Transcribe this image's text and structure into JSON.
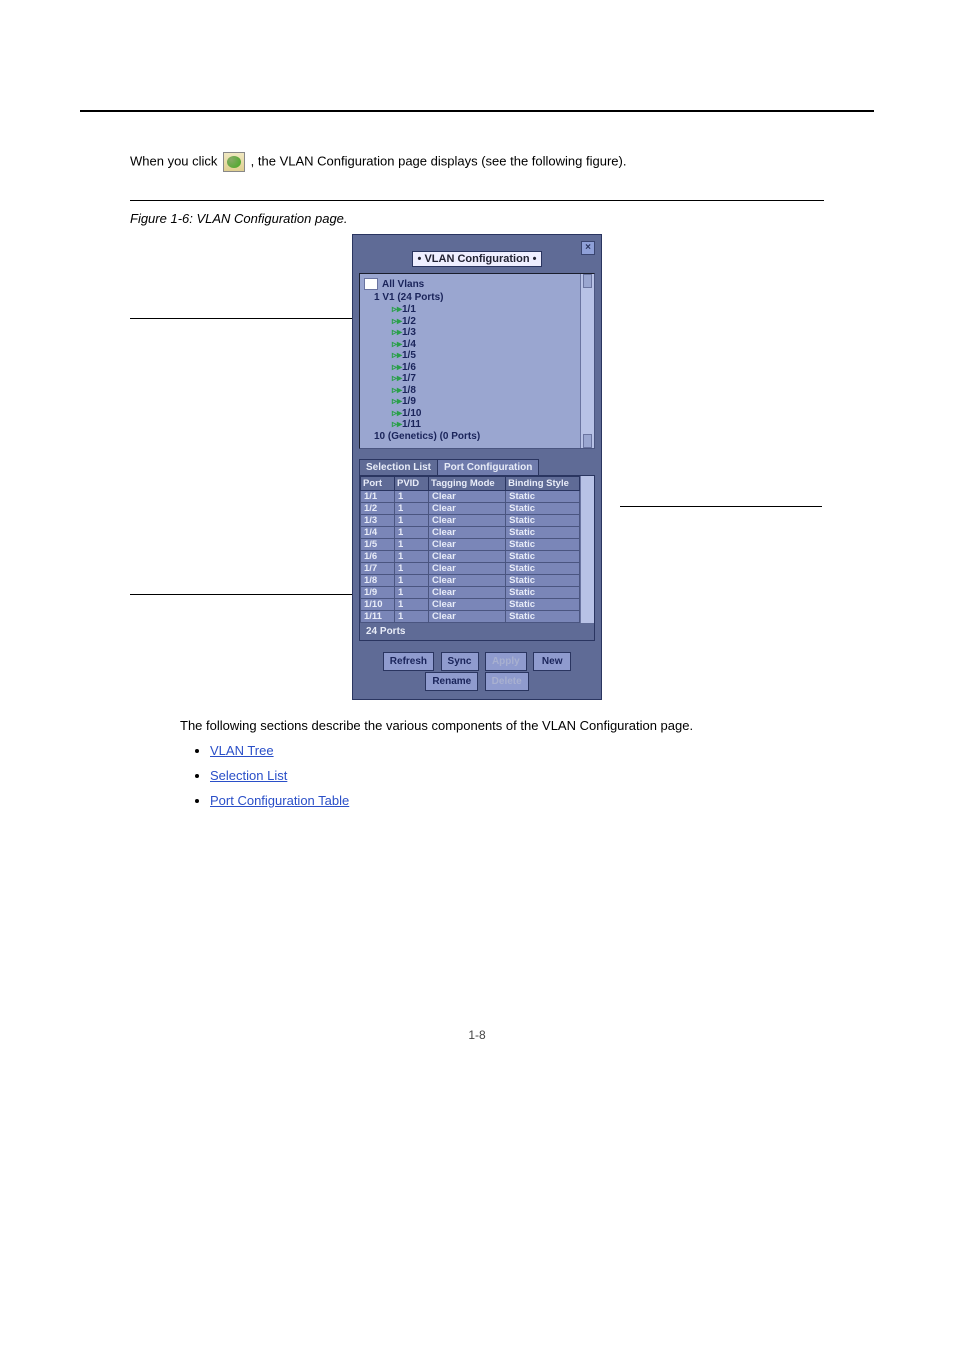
{
  "page": {
    "intro_prefix": "When you click ",
    "intro_suffix": ", the VLAN Configuration page displays (see the following figure).",
    "fig_caption": "Figure 1-6: VLAN Configuration page.",
    "post_fig": "The following sections describe the various components of the VLAN Configuration page.",
    "page_number": "1-8"
  },
  "icon": {
    "name": "vlan-config-icon"
  },
  "vlan_window": {
    "title": "• VLAN Configuration •",
    "close_glyph": "×",
    "tree": {
      "root": "All Vlans",
      "v1": "1    V1   (24 Ports)",
      "ports": [
        "1/1",
        "1/2",
        "1/3",
        "1/4",
        "1/5",
        "1/6",
        "1/7",
        "1/8",
        "1/9",
        "1/10",
        "1/11"
      ],
      "last": "10    (Genetics)  (0 Ports)"
    },
    "tabs": {
      "selection": "Selection List",
      "portconf": "Port Configuration"
    },
    "table": {
      "headers": [
        "Port",
        "PVID",
        "Tagging Mode",
        "Binding Style"
      ],
      "rows": [
        [
          "1/1",
          "1",
          "Clear",
          "Static"
        ],
        [
          "1/2",
          "1",
          "Clear",
          "Static"
        ],
        [
          "1/3",
          "1",
          "Clear",
          "Static"
        ],
        [
          "1/4",
          "1",
          "Clear",
          "Static"
        ],
        [
          "1/5",
          "1",
          "Clear",
          "Static"
        ],
        [
          "1/6",
          "1",
          "Clear",
          "Static"
        ],
        [
          "1/7",
          "1",
          "Clear",
          "Static"
        ],
        [
          "1/8",
          "1",
          "Clear",
          "Static"
        ],
        [
          "1/9",
          "1",
          "Clear",
          "Static"
        ],
        [
          "1/10",
          "1",
          "Clear",
          "Static"
        ],
        [
          "1/11",
          "1",
          "Clear",
          "Static"
        ]
      ],
      "footer": "24 Ports"
    },
    "buttons": {
      "refresh": "Refresh",
      "sync": "Sync",
      "apply": "Apply",
      "new": "New",
      "rename": "Rename",
      "delete": "Delete"
    }
  },
  "links": {
    "l1": "VLAN Tree",
    "l2": "Selection List",
    "l3": "Port Configuration Table"
  }
}
